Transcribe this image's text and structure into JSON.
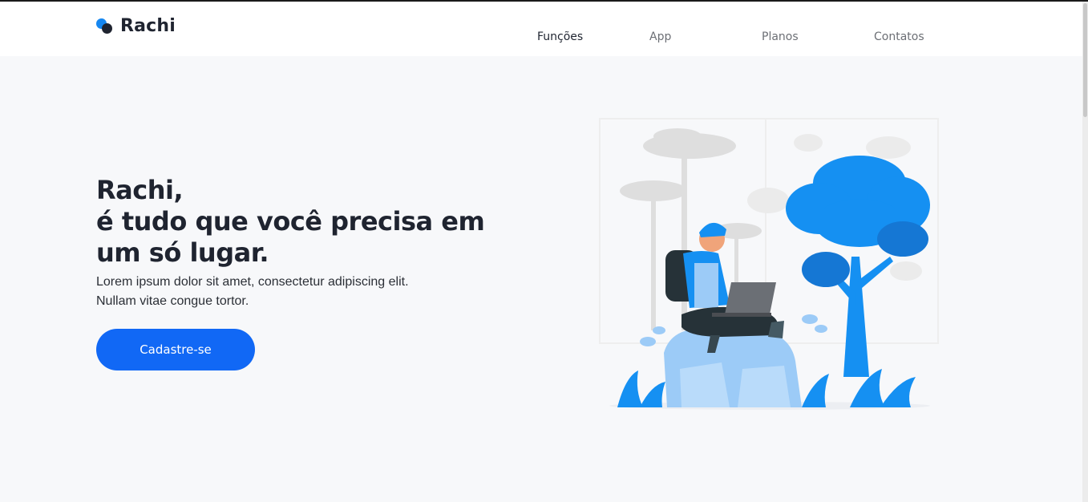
{
  "brand": {
    "name": "Rachi"
  },
  "nav": {
    "items": [
      {
        "label": "Funções",
        "active": true
      },
      {
        "label": "App",
        "active": false
      },
      {
        "label": "Planos",
        "active": false
      },
      {
        "label": "Contatos",
        "active": false
      }
    ]
  },
  "hero": {
    "title_lines": [
      "Rachi,",
      "é tudo que você precisa em",
      "um só lugar."
    ],
    "text_lines": [
      "Lorem ipsum dolor sit amet, consectetur adipiscing elit.",
      "Nullam vitae congue tortor."
    ],
    "cta_label": "Cadastre-se"
  },
  "colors": {
    "accent": "#1168f5",
    "tree_blue": "#1590f2",
    "dark_text": "#1f2430",
    "background": "#f7f8fa"
  },
  "icons": {
    "logo": "two-dots-logo-icon",
    "illustration": "person-with-laptop-on-rock-illustration"
  }
}
